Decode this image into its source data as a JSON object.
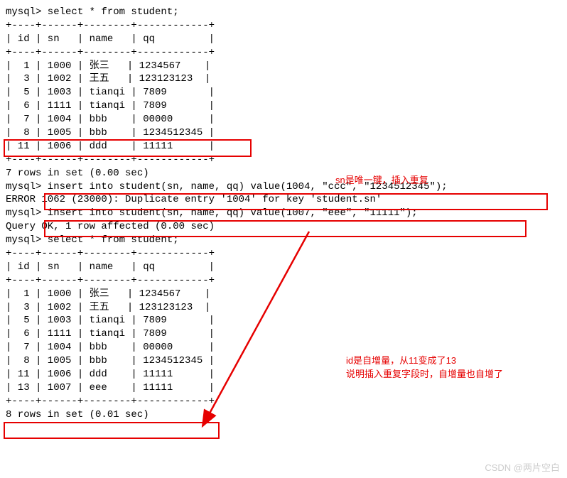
{
  "terminal": {
    "query1_prompt": "mysql> select * from student;",
    "divider1": "+----+------+--------+------------+",
    "header1": "| id | sn   | name   | qq         |",
    "rows1": [
      "|  1 | 1000 | 张三   | 1234567    |",
      "|  3 | 1002 | 王五   | 123123123  |",
      "|  5 | 1003 | tianqi | 7809       |",
      "|  6 | 1111 | tianqi | 7809       |",
      "|  7 | 1004 | bbb    | 00000      |",
      "|  8 | 1005 | bbb    | 1234512345 |",
      "| 11 | 1006 | ddd    | 11111      |"
    ],
    "result1_summary": "7 rows in set (0.00 sec)",
    "blank": "",
    "insert1": "mysql> insert into student(sn, name, qq) value(1004, \"ccc\", \"1234512345\");",
    "error1": "ERROR 1062 (23000): Duplicate entry '1004' for key 'student.sn'",
    "insert2": "mysql> insert into student(sn, name, qq) value(1007, \"eee\", \"11111\");",
    "ok2": "Query OK, 1 row affected (0.00 sec)",
    "query2_prompt": "mysql> select * from student;",
    "divider2": "+----+------+--------+------------+",
    "header2": "| id | sn   | name   | qq         |",
    "rows2": [
      "|  1 | 1000 | 张三   | 1234567    |",
      "|  3 | 1002 | 王五   | 123123123  |",
      "|  5 | 1003 | tianqi | 7809       |",
      "|  6 | 1111 | tianqi | 7809       |",
      "|  7 | 1004 | bbb    | 00000      |",
      "|  8 | 1005 | bbb    | 1234512345 |",
      "| 11 | 1006 | ddd    | 11111      |",
      "| 13 | 1007 | eee    | 11111      |"
    ],
    "result2_summary": "8 rows in set (0.01 sec)"
  },
  "annotations": {
    "note1": "sn是唯一键，插入重复",
    "note2_line1": "id是自增量，从11变成了13",
    "note2_line2": "说明插入重复字段时，自增量也自增了",
    "watermark": "CSDN @两片空白"
  }
}
